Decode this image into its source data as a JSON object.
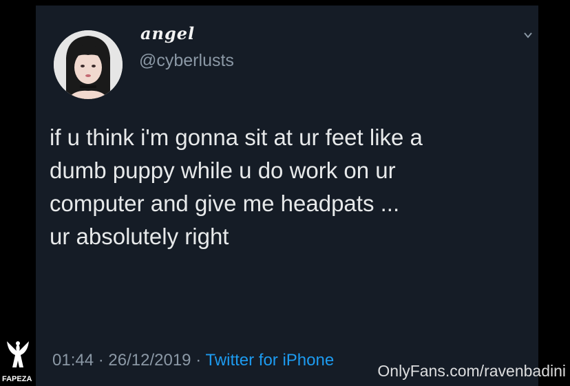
{
  "tweet": {
    "display_name": "angel",
    "handle": "@cyberlusts",
    "text_lines": [
      "if u think i'm gonna sit at ur feet like a",
      "dumb puppy while u do work on ur",
      "computer and give me headpats ...",
      "ur absolutely right"
    ],
    "time": "01:44",
    "separator": "·",
    "date": "26/12/2019",
    "client": "Twitter for iPhone",
    "menu_icon": "chevron-down-icon"
  },
  "watermarks": {
    "left_label": "FAPEZA",
    "left_icon": "winged-figure-logo",
    "right_text": "OnlyFans.com/ravenbadini"
  },
  "colors": {
    "card_background": "#151c26",
    "text_primary": "#e7e9ea",
    "text_secondary": "#8b98a5",
    "link_blue": "#1d9bf0"
  }
}
